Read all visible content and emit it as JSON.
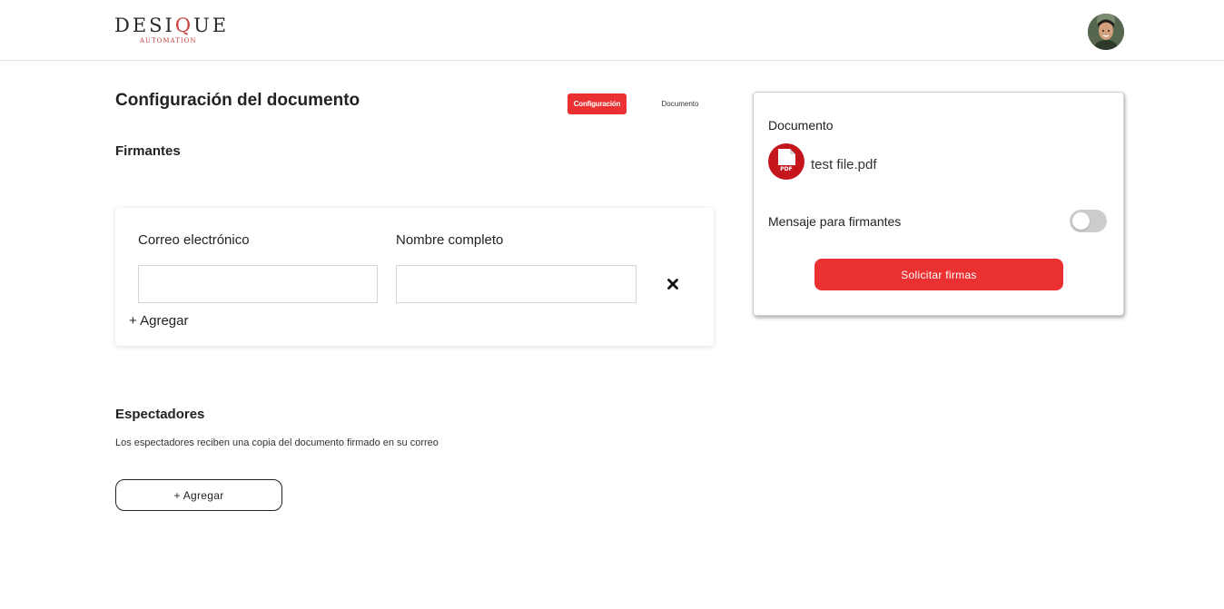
{
  "brand": {
    "logo_main_left": "DESI",
    "logo_main_q": "Q",
    "logo_main_right": "UE",
    "logo_sub": "AUTOMATION",
    "accent_color": "#ea3030"
  },
  "header": {
    "avatar_icon": "user-avatar"
  },
  "page": {
    "title": "Configuración del documento"
  },
  "tabs": [
    {
      "label": "Configuración",
      "active": true
    },
    {
      "label": "Documento",
      "active": false
    }
  ],
  "signers": {
    "title": "Firmantes",
    "email_label": "Correo electrónico",
    "name_label": "Nombre completo",
    "email_value": "",
    "name_value": "",
    "remove_icon": "close-icon",
    "add_label": "+ Agregar"
  },
  "viewers": {
    "title": "Espectadores",
    "description": "Los espectadores reciben una copia del documento firmado en su correo",
    "add_label": "+ Agregar"
  },
  "document_panel": {
    "heading": "Documento",
    "file_icon": "pdf-icon",
    "file_icon_text": "PDF",
    "file_name": "test file.pdf",
    "message_label": "Mensaje para firmantes",
    "message_toggle_on": false,
    "request_button": "Solicitar firmas"
  }
}
